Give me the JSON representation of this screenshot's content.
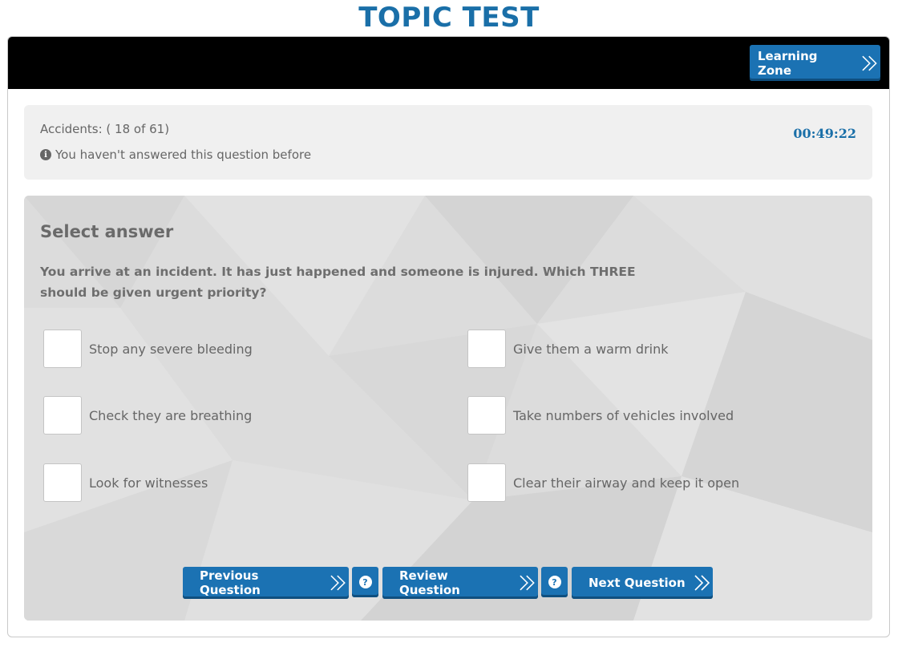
{
  "page": {
    "title": "TOPIC TEST"
  },
  "header": {
    "learning_zone_label": "Learning Zone"
  },
  "status": {
    "category": "Accidents: ( 18 of 61)",
    "note": "You haven't answered this question before",
    "timer": "00:49:22"
  },
  "question": {
    "heading": "Select answer",
    "text": "You arrive at an incident. It has just happened and someone is injured. Which THREE should be given urgent priority?",
    "options": [
      {
        "label": "Stop any severe bleeding",
        "checked": false
      },
      {
        "label": "Give them a warm drink",
        "checked": false
      },
      {
        "label": "Check they are breathing",
        "checked": false
      },
      {
        "label": "Take numbers of vehicles involved",
        "checked": false
      },
      {
        "label": "Look for witnesses",
        "checked": false
      },
      {
        "label": "Clear their airway and keep it open",
        "checked": false
      }
    ]
  },
  "navigation": {
    "previous_label": "Previous Question",
    "review_label": "Review Question",
    "next_label": "Next Question"
  },
  "colors": {
    "accent": "#1b72b3",
    "title": "#1a6fa8",
    "topbar": "#000000",
    "panel": "#f0f0f0"
  }
}
